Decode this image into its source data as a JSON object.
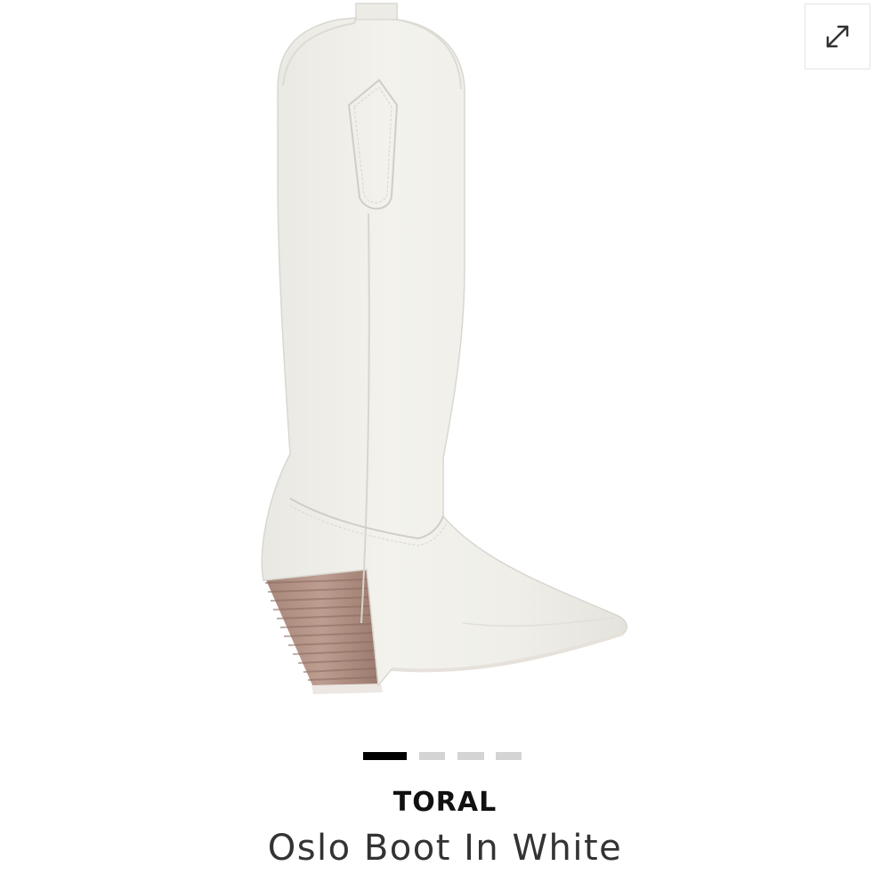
{
  "gallery": {
    "image_alt": "white western knee-high boot with stacked wooden heel",
    "expand_icon": "expand-arrows-icon",
    "slides_total": 4,
    "active_slide": 1,
    "colors": {
      "active_dot": "#000000",
      "inactive_dot": "#d4d4d4",
      "boot": "#efeee8",
      "heel": "#b08f82"
    }
  },
  "product": {
    "brand": "TORAL",
    "name": "Oslo Boot In White"
  }
}
